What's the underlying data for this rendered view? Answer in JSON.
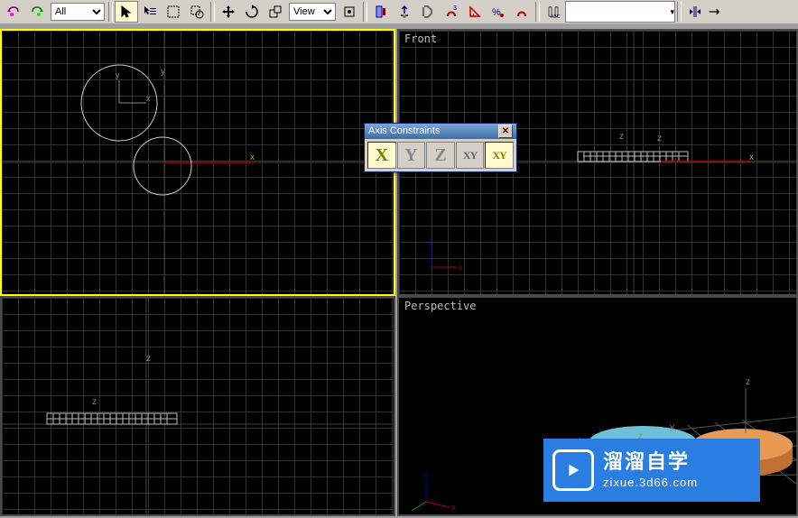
{
  "toolbar": {
    "selection_filter_label": "All",
    "coord_sys_label": "View"
  },
  "viewports": {
    "top_left_label": "",
    "top_right_label": "Front",
    "bottom_left_label": "",
    "bottom_right_label": "Perspective"
  },
  "axis_constraints": {
    "title": "Axis Constraints",
    "buttons": {
      "x": "X",
      "y": "Y",
      "z": "Z",
      "xy": "XY",
      "xy2": "XY"
    },
    "active": "X"
  },
  "axes": {
    "x": "x",
    "y": "y",
    "z": "z"
  },
  "watermark": {
    "chinese": "溜溜自学",
    "url": "zixue.3d66.com"
  },
  "colors": {
    "toolbar_bg": "#d4d0c8",
    "viewport_active_border": "#ffff00",
    "viewport_bg": "#000000",
    "grid_line": "#323232",
    "axis_x": "#aa0000",
    "axis_y": "#00aa00",
    "axis_z": "#0000aa",
    "watermark_bg": "#2a7de1"
  }
}
